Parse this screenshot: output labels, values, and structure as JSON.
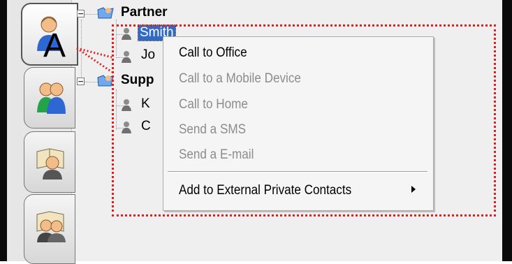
{
  "tree": {
    "groups": [
      {
        "label": "Partner",
        "contacts": [
          {
            "label": "Smith"
          },
          {
            "label": "Jo"
          }
        ]
      },
      {
        "label": "Supp",
        "contacts": [
          {
            "label": "K"
          },
          {
            "label": "C"
          }
        ]
      }
    ]
  },
  "callout": {
    "label": "A"
  },
  "context_menu": {
    "items": [
      {
        "label": "Call to Office",
        "enabled": true
      },
      {
        "label": "Call to a Mobile Device",
        "enabled": false
      },
      {
        "label": "Call to Home",
        "enabled": false
      },
      {
        "label": "Send a SMS",
        "enabled": false
      },
      {
        "label": "Send a E-mail",
        "enabled": false
      },
      {
        "label": "Add to External Private Contacts",
        "enabled": true,
        "has_submenu": true
      }
    ]
  },
  "colors": {
    "selection": "#316ac5",
    "annotation": "#e02020"
  },
  "icons": {
    "tab_1": "single-contact-icon",
    "tab_2": "group-contacts-icon",
    "tab_3": "contact-book-icon",
    "tab_4": "shared-contact-book-icon",
    "group": "folder-user-icon",
    "contact": "person-icon",
    "submenu": "triangle-right-icon"
  }
}
